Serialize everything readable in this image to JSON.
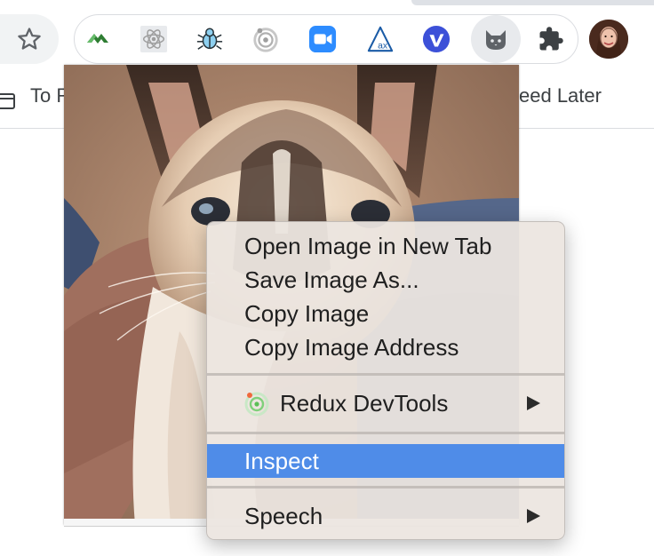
{
  "toolbar": {
    "star_icon": "star-outline-icon",
    "extensions": [
      {
        "name": "ext-green-chevron-icon",
        "color": "#34a853"
      },
      {
        "name": "ext-react-icon",
        "color": "#8a8a8a"
      },
      {
        "name": "ext-bug-icon",
        "color": "#1a73e8"
      },
      {
        "name": "ext-redux-ring-icon",
        "color": "#9aa0a6"
      },
      {
        "name": "ext-zoom-camera-icon",
        "color": "#2d8cff"
      },
      {
        "name": "ext-axe-icon",
        "color": "#1a5ba6"
      },
      {
        "name": "ext-vimeo-icon",
        "color": "#3c50d8"
      },
      {
        "name": "ext-cat-icon",
        "color": "#5f6368"
      },
      {
        "name": "extensions-puzzle-icon",
        "color": "#3c4043"
      }
    ],
    "avatar": "profile-avatar"
  },
  "bookmarks": {
    "left_label": "To R",
    "right_label": "eed Later"
  },
  "context_menu": {
    "items": [
      {
        "label": "Open Image in New Tab"
      },
      {
        "label": "Save Image As..."
      },
      {
        "label": "Copy Image"
      },
      {
        "label": "Copy Image Address"
      },
      {
        "label": "Redux DevTools",
        "submenu": true
      },
      {
        "label": "Inspect",
        "highlighted": true
      },
      {
        "label": "Speech",
        "submenu": true
      }
    ],
    "highlight_color": "#4f8ce8"
  }
}
